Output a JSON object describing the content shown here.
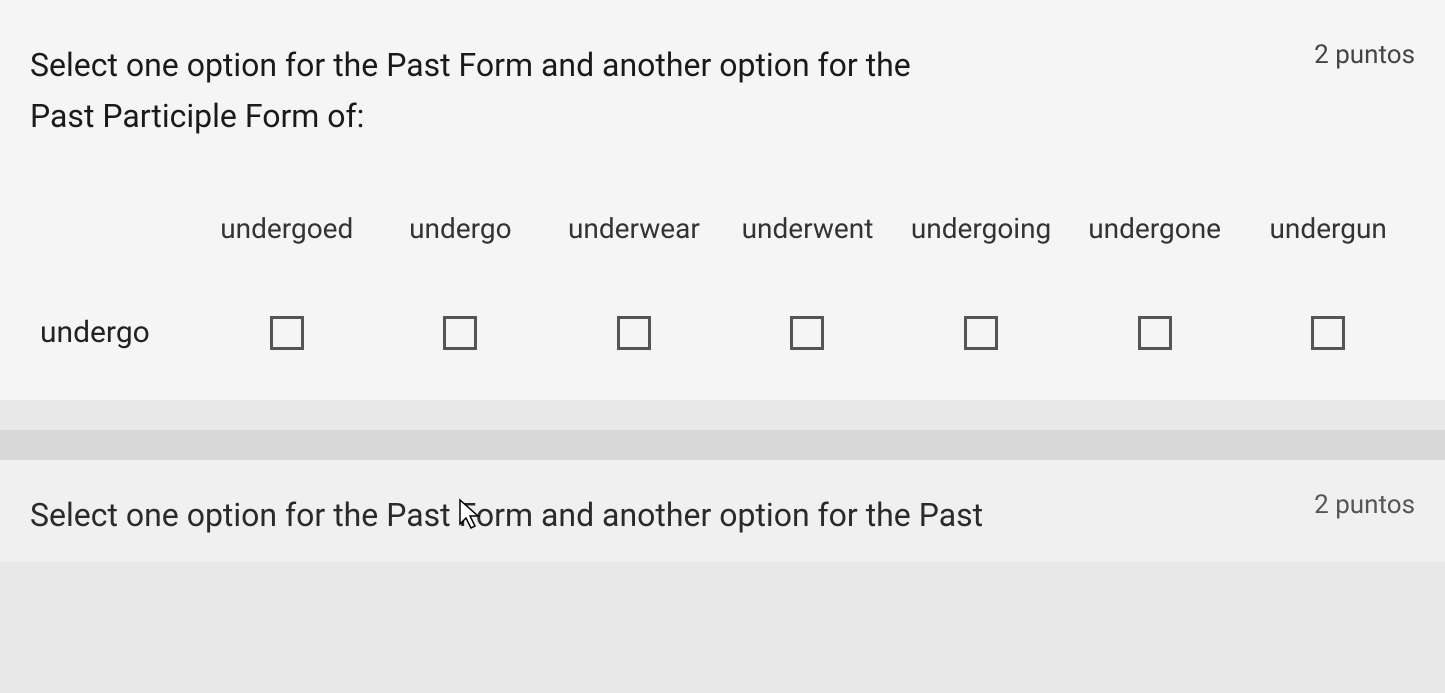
{
  "question1": {
    "title": "Select one option for the Past Form and another option for the Past Participle Form of:",
    "points": "2 puntos",
    "columns": [
      "undergoed",
      "undergo",
      "underwear",
      "underwent",
      "undergoing",
      "undergone",
      "undergun"
    ],
    "rowLabel": "undergo"
  },
  "question2": {
    "title": "Select one option for the Past Form and another option for the Past",
    "points": "2 puntos"
  }
}
